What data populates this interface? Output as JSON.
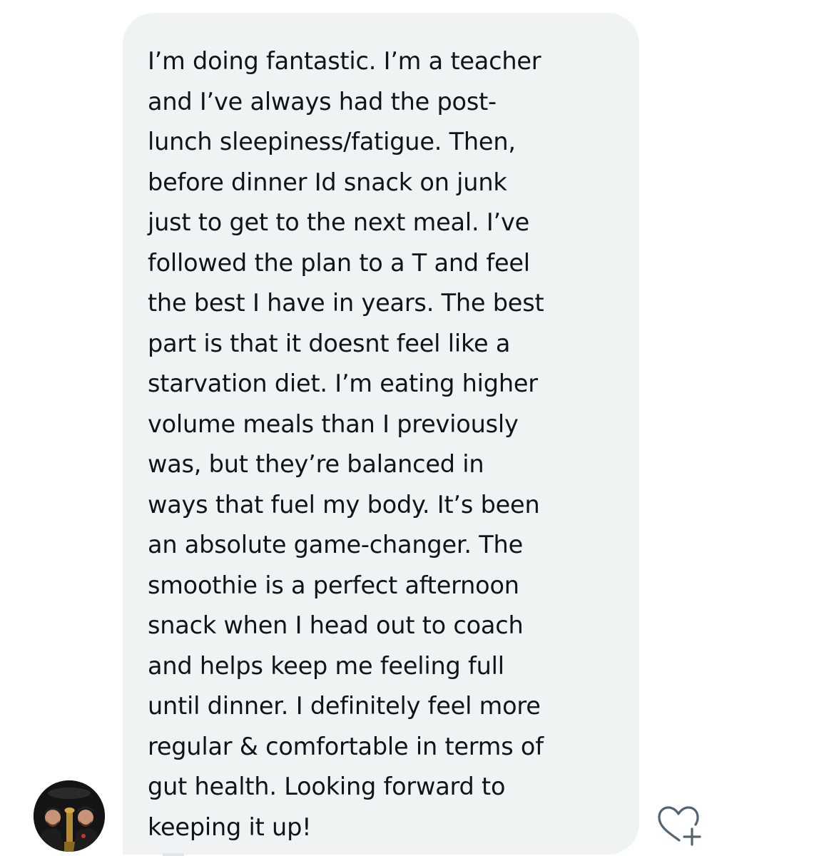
{
  "conversation": {
    "message": {
      "lines": [
        "I’m doing fantastic. I’m a teacher",
        "and I’ve always had the post-",
        "lunch sleepiness/fatigue. Then,",
        "before dinner Id snack on junk",
        "just to get to the next meal. I’ve",
        "followed the plan to a T and feel",
        "the best I have in years. The best",
        "part is that it doesnt feel like a",
        "starvation diet. I’m eating higher",
        "volume meals than I previously",
        "was, but they’re balanced in",
        "ways that fuel my body. It’s been",
        "an absolute game-changer. The",
        "smoothie is a perfect afternoon",
        "snack when I head out to coach",
        "and helps keep me feeling full",
        "until dinner. I definitely feel more",
        "regular & comfortable in terms of",
        "gut health. Looking forward to",
        "keeping it up!"
      ]
    },
    "avatar_icon": "profile-photo",
    "react_icon": "heart-plus-icon"
  },
  "colors": {
    "bubble_background": "#eff3f4",
    "text": "#0f1419",
    "icon": "#536471"
  }
}
